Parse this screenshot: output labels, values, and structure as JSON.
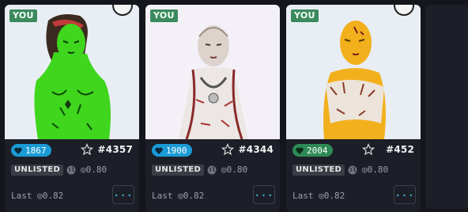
{
  "cards": [
    {
      "badge": "YOU",
      "likes": "1867",
      "likes_color": "#1b9bd6",
      "token_id": "#4357",
      "status": "UNLISTED",
      "price": "◎0.80",
      "last": "Last ◎0.82",
      "more": "...",
      "image": "green-character-art",
      "bg": "#e9eef5"
    },
    {
      "badge": "YOU",
      "likes": "1900",
      "likes_color": "#1b9bd6",
      "token_id": "#4344",
      "status": "UNLISTED",
      "price": "◎0.80",
      "last": "Last ◎0.82",
      "more": "...",
      "image": "pale-character-art",
      "bg": "#f3f1f7"
    },
    {
      "badge": "YOU",
      "likes": "2004",
      "likes_color": "#2e8a55",
      "token_id": "#452",
      "status": "UNLISTED",
      "price": "◎0.80",
      "last": "Last ◎0.82",
      "more": "...",
      "image": "gold-character-art",
      "bg": "#e9eef5"
    }
  ]
}
